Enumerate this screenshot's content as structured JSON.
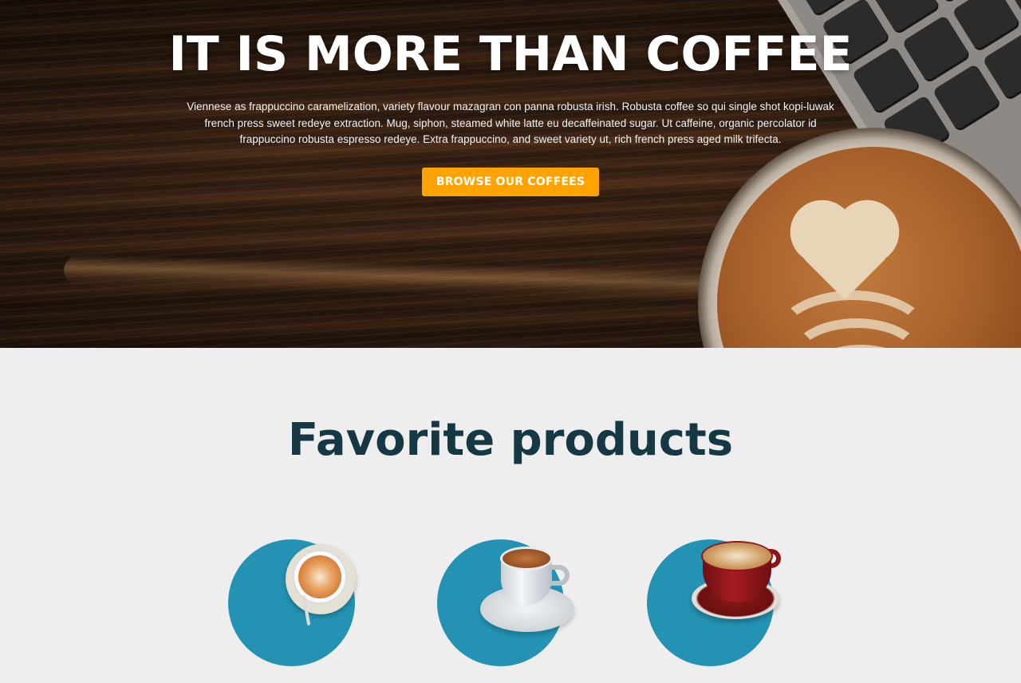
{
  "hero": {
    "title": "IT IS MORE THAN COFFEE",
    "text": "Viennese as frappuccino caramelization, variety flavour mazagran con panna robusta irish. Robusta coffee so qui single shot kopi-luwak french press sweet redeye extraction. Mug, siphon, steamed white latte eu decaffeinated sugar. Ut caffeine, organic percolator id frappuccino robusta espresso redeye. Extra frappuccino, and sweet variety ut, rich french press aged milk trifecta.",
    "button_label": "BROWSE OUR COFFEES",
    "button_color": "#ffa300"
  },
  "products": {
    "title": "Favorite products",
    "title_color": "#163744",
    "circle_color": "#2492b2",
    "items": [
      {
        "icon": "latte-cup-icon"
      },
      {
        "icon": "espresso-cup-icon"
      },
      {
        "icon": "cappuccino-cup-icon"
      }
    ]
  }
}
